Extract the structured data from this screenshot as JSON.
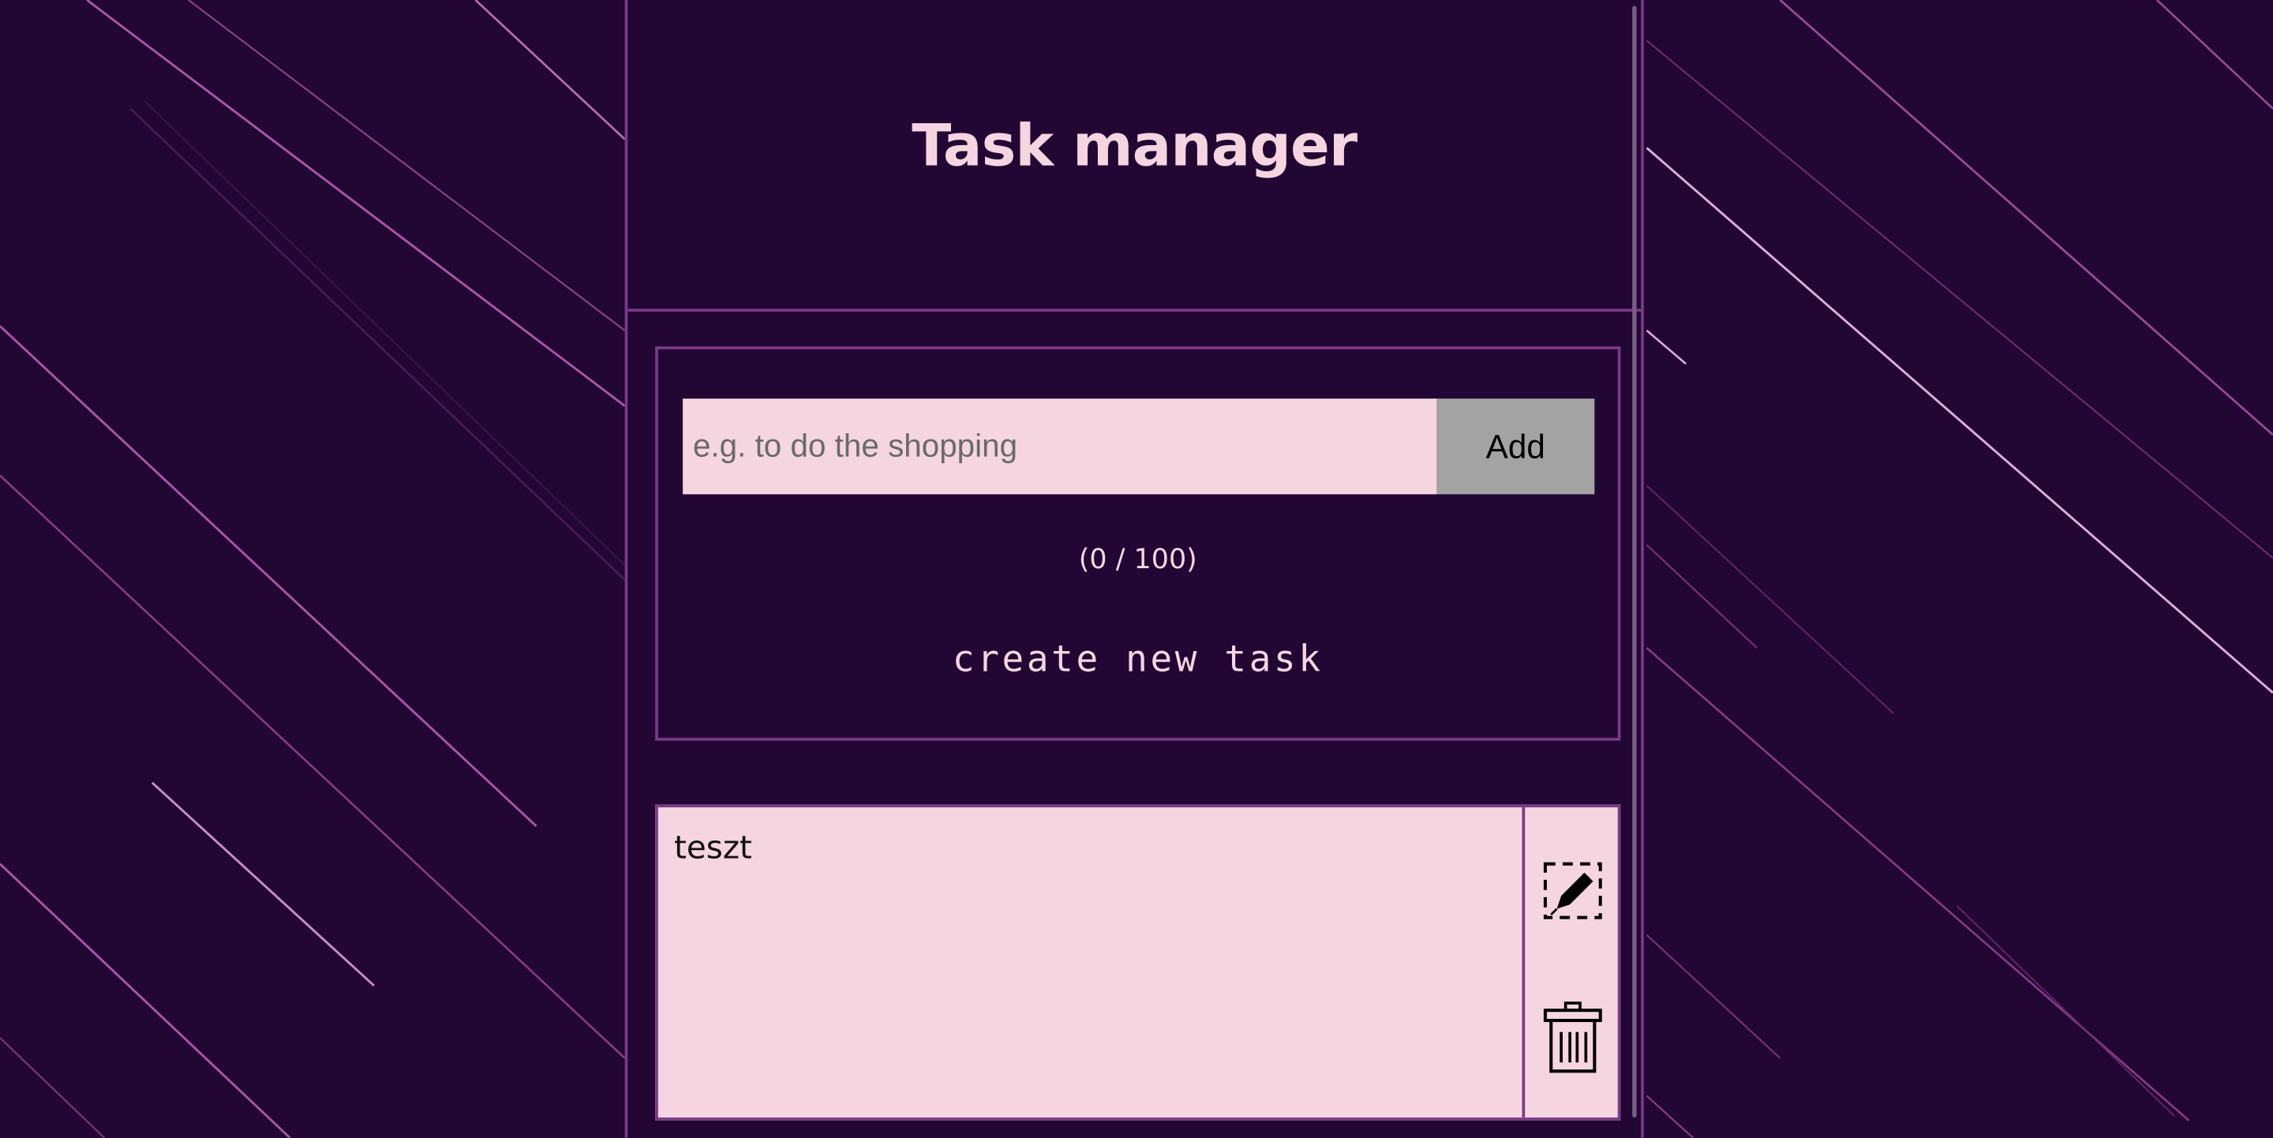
{
  "header": {
    "title": "Task manager"
  },
  "create_form": {
    "input_placeholder": "e.g. to do the shopping",
    "input_value": "",
    "add_label": "Add",
    "char_counter": "(0 / 100)",
    "section_label": "create new task"
  },
  "tasks": [
    {
      "text": "teszt",
      "edit_icon": "pencil-in-dashed-box-icon",
      "delete_icon": "trash-can-icon"
    }
  ],
  "colors": {
    "background": "#220634",
    "border_accent": "#7a3a86",
    "text_light": "#f5d5e0",
    "input_bg": "#f5d5e0",
    "button_bg": "#a3a3a3"
  }
}
